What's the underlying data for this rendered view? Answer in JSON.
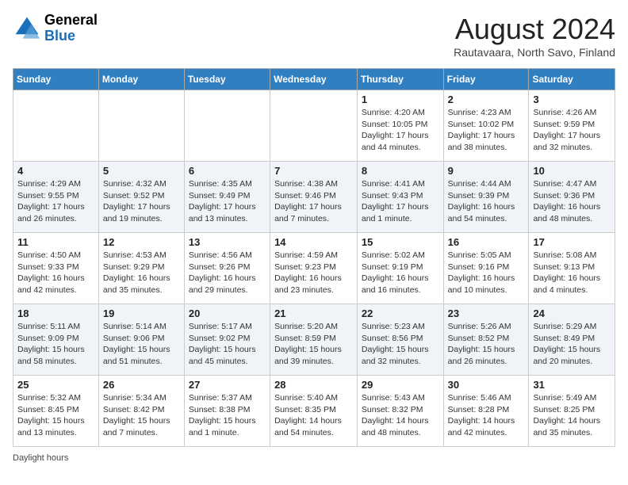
{
  "header": {
    "logo_general": "General",
    "logo_blue": "Blue",
    "month_title": "August 2024",
    "subtitle": "Rautavaara, North Savo, Finland"
  },
  "days_of_week": [
    "Sunday",
    "Monday",
    "Tuesday",
    "Wednesday",
    "Thursday",
    "Friday",
    "Saturday"
  ],
  "weeks": [
    [
      {
        "day": "",
        "info": ""
      },
      {
        "day": "",
        "info": ""
      },
      {
        "day": "",
        "info": ""
      },
      {
        "day": "",
        "info": ""
      },
      {
        "day": "1",
        "info": "Sunrise: 4:20 AM\nSunset: 10:05 PM\nDaylight: 17 hours and 44 minutes."
      },
      {
        "day": "2",
        "info": "Sunrise: 4:23 AM\nSunset: 10:02 PM\nDaylight: 17 hours and 38 minutes."
      },
      {
        "day": "3",
        "info": "Sunrise: 4:26 AM\nSunset: 9:59 PM\nDaylight: 17 hours and 32 minutes."
      }
    ],
    [
      {
        "day": "4",
        "info": "Sunrise: 4:29 AM\nSunset: 9:55 PM\nDaylight: 17 hours and 26 minutes."
      },
      {
        "day": "5",
        "info": "Sunrise: 4:32 AM\nSunset: 9:52 PM\nDaylight: 17 hours and 19 minutes."
      },
      {
        "day": "6",
        "info": "Sunrise: 4:35 AM\nSunset: 9:49 PM\nDaylight: 17 hours and 13 minutes."
      },
      {
        "day": "7",
        "info": "Sunrise: 4:38 AM\nSunset: 9:46 PM\nDaylight: 17 hours and 7 minutes."
      },
      {
        "day": "8",
        "info": "Sunrise: 4:41 AM\nSunset: 9:43 PM\nDaylight: 17 hours and 1 minute."
      },
      {
        "day": "9",
        "info": "Sunrise: 4:44 AM\nSunset: 9:39 PM\nDaylight: 16 hours and 54 minutes."
      },
      {
        "day": "10",
        "info": "Sunrise: 4:47 AM\nSunset: 9:36 PM\nDaylight: 16 hours and 48 minutes."
      }
    ],
    [
      {
        "day": "11",
        "info": "Sunrise: 4:50 AM\nSunset: 9:33 PM\nDaylight: 16 hours and 42 minutes."
      },
      {
        "day": "12",
        "info": "Sunrise: 4:53 AM\nSunset: 9:29 PM\nDaylight: 16 hours and 35 minutes."
      },
      {
        "day": "13",
        "info": "Sunrise: 4:56 AM\nSunset: 9:26 PM\nDaylight: 16 hours and 29 minutes."
      },
      {
        "day": "14",
        "info": "Sunrise: 4:59 AM\nSunset: 9:23 PM\nDaylight: 16 hours and 23 minutes."
      },
      {
        "day": "15",
        "info": "Sunrise: 5:02 AM\nSunset: 9:19 PM\nDaylight: 16 hours and 16 minutes."
      },
      {
        "day": "16",
        "info": "Sunrise: 5:05 AM\nSunset: 9:16 PM\nDaylight: 16 hours and 10 minutes."
      },
      {
        "day": "17",
        "info": "Sunrise: 5:08 AM\nSunset: 9:13 PM\nDaylight: 16 hours and 4 minutes."
      }
    ],
    [
      {
        "day": "18",
        "info": "Sunrise: 5:11 AM\nSunset: 9:09 PM\nDaylight: 15 hours and 58 minutes."
      },
      {
        "day": "19",
        "info": "Sunrise: 5:14 AM\nSunset: 9:06 PM\nDaylight: 15 hours and 51 minutes."
      },
      {
        "day": "20",
        "info": "Sunrise: 5:17 AM\nSunset: 9:02 PM\nDaylight: 15 hours and 45 minutes."
      },
      {
        "day": "21",
        "info": "Sunrise: 5:20 AM\nSunset: 8:59 PM\nDaylight: 15 hours and 39 minutes."
      },
      {
        "day": "22",
        "info": "Sunrise: 5:23 AM\nSunset: 8:56 PM\nDaylight: 15 hours and 32 minutes."
      },
      {
        "day": "23",
        "info": "Sunrise: 5:26 AM\nSunset: 8:52 PM\nDaylight: 15 hours and 26 minutes."
      },
      {
        "day": "24",
        "info": "Sunrise: 5:29 AM\nSunset: 8:49 PM\nDaylight: 15 hours and 20 minutes."
      }
    ],
    [
      {
        "day": "25",
        "info": "Sunrise: 5:32 AM\nSunset: 8:45 PM\nDaylight: 15 hours and 13 minutes."
      },
      {
        "day": "26",
        "info": "Sunrise: 5:34 AM\nSunset: 8:42 PM\nDaylight: 15 hours and 7 minutes."
      },
      {
        "day": "27",
        "info": "Sunrise: 5:37 AM\nSunset: 8:38 PM\nDaylight: 15 hours and 1 minute."
      },
      {
        "day": "28",
        "info": "Sunrise: 5:40 AM\nSunset: 8:35 PM\nDaylight: 14 hours and 54 minutes."
      },
      {
        "day": "29",
        "info": "Sunrise: 5:43 AM\nSunset: 8:32 PM\nDaylight: 14 hours and 48 minutes."
      },
      {
        "day": "30",
        "info": "Sunrise: 5:46 AM\nSunset: 8:28 PM\nDaylight: 14 hours and 42 minutes."
      },
      {
        "day": "31",
        "info": "Sunrise: 5:49 AM\nSunset: 8:25 PM\nDaylight: 14 hours and 35 minutes."
      }
    ]
  ],
  "footer": {
    "daylight_hours_label": "Daylight hours"
  }
}
